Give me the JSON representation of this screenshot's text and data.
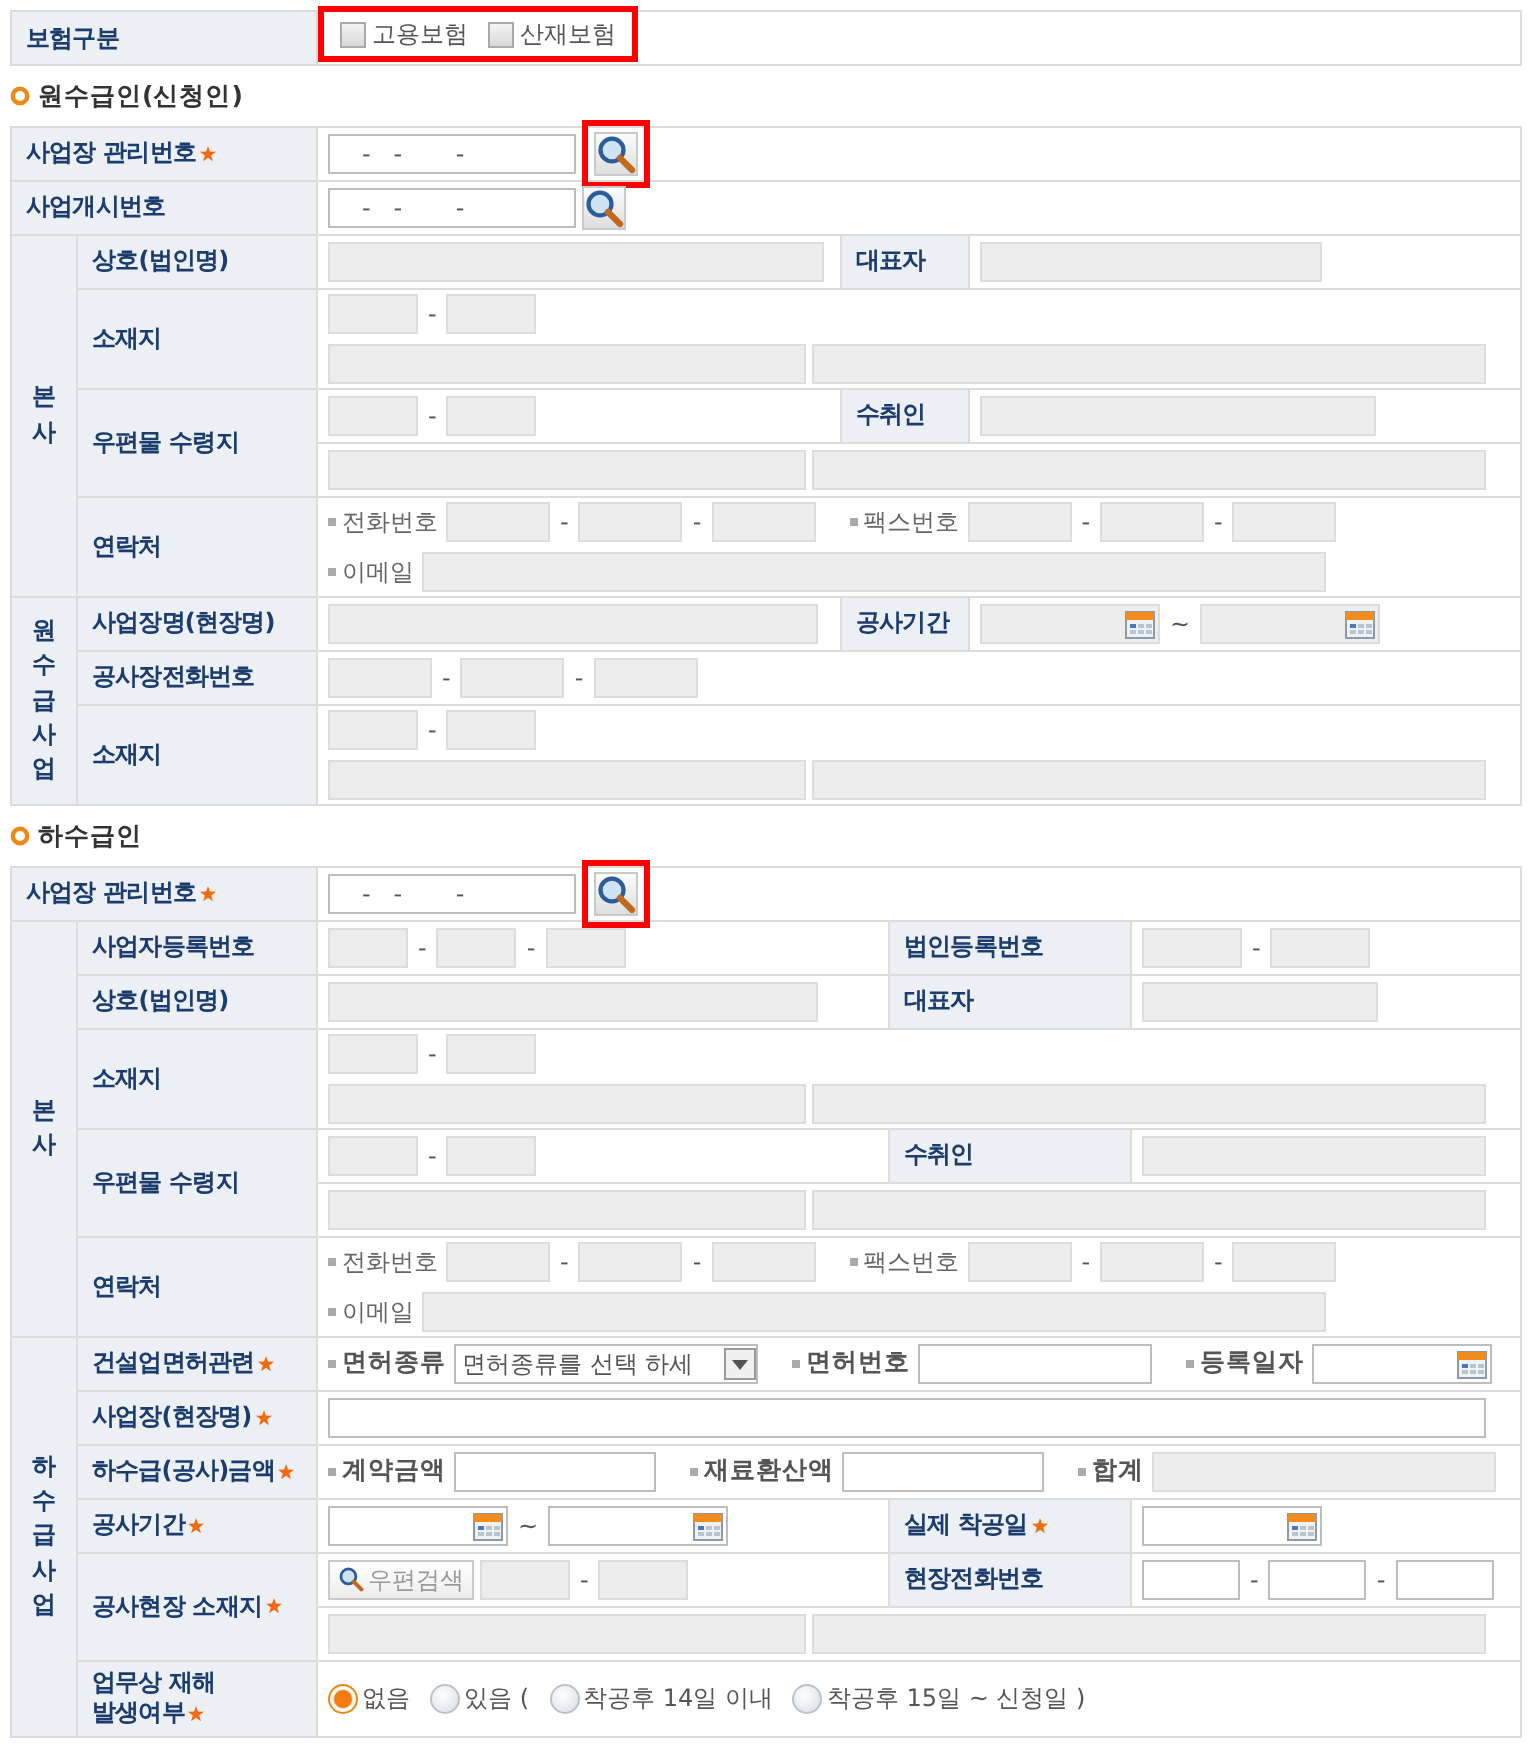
{
  "insurance_type": {
    "label": "보험구분",
    "highlighted": true,
    "options": [
      {
        "label": "고용보험",
        "checked": false
      },
      {
        "label": "산재보험",
        "checked": false
      }
    ]
  },
  "sections": [
    {
      "title": "원수급인(신청인)",
      "rows": [
        {
          "label": "사업장 관리번호",
          "required": true,
          "lines": [
            [
              {
                "kind": "mgmt-no",
                "value": "-   -       -",
                "disabled": false
              },
              {
                "kind": "lookup",
                "highlighted": true
              }
            ]
          ]
        },
        {
          "label": "사업개시번호",
          "lines": [
            [
              {
                "kind": "mgmt-no",
                "value": "-   -       -",
                "disabled": false
              },
              {
                "kind": "lookup",
                "highlighted": false
              }
            ]
          ]
        },
        {
          "group": "본사",
          "rows": [
            {
              "label": "상호(법인명)",
              "lines": [
                [
                  {
                    "kind": "name",
                    "disabled": true
                  }
                ]
              ],
              "side": {
                "label": "대표자",
                "lines": [
                  [
                    {
                      "kind": "ceo",
                      "disabled": true
                    }
                  ]
                ]
              }
            },
            {
              "label": "소재지",
              "lines": [
                [
                  {
                    "kind": "zip",
                    "disabled": true
                  },
                  {
                    "kind": "dash",
                    "text": "-"
                  },
                  {
                    "kind": "zip",
                    "disabled": true
                  }
                ],
                [
                  {
                    "kind": "addr-base",
                    "disabled": true
                  },
                  {
                    "kind": "addr-detail",
                    "disabled": true
                  }
                ]
              ]
            },
            {
              "label": "우편물 수령지",
              "lines": [
                [
                  {
                    "kind": "zip",
                    "disabled": true
                  },
                  {
                    "kind": "dash",
                    "text": "-"
                  },
                  {
                    "kind": "zip",
                    "disabled": true
                  }
                ]
              ],
              "side": {
                "label": "수취인",
                "lines": [
                  [
                    {
                      "kind": "recipient",
                      "disabled": true
                    }
                  ]
                ]
              },
              "next_line": [
                {
                  "kind": "addr-base",
                  "disabled": true
                },
                {
                  "kind": "addr-detail",
                  "disabled": true
                }
              ]
            },
            {
              "label": "연락처",
              "lines": [
                [
                  {
                    "kind": "caption",
                    "text": "전화번호",
                    "bold": false
                  },
                  {
                    "kind": "phone",
                    "disabled": true
                  },
                  {
                    "kind": "dash",
                    "text": "-"
                  },
                  {
                    "kind": "phone",
                    "disabled": true
                  },
                  {
                    "kind": "dash",
                    "text": "-"
                  },
                  {
                    "kind": "phone",
                    "disabled": true
                  },
                  {
                    "kind": "caption",
                    "text": "팩스번호",
                    "bold": false
                  },
                  {
                    "kind": "phone",
                    "disabled": true
                  },
                  {
                    "kind": "dash",
                    "text": "-"
                  },
                  {
                    "kind": "phone",
                    "disabled": true
                  },
                  {
                    "kind": "dash",
                    "text": "-"
                  },
                  {
                    "kind": "phone",
                    "disabled": true
                  }
                ],
                [
                  {
                    "kind": "caption",
                    "text": "이메일",
                    "bold": false
                  },
                  {
                    "kind": "email",
                    "disabled": true
                  }
                ]
              ]
            }
          ]
        },
        {
          "group": "원수급사업",
          "rows": [
            {
              "label": "사업장명(현장명)",
              "lines": [
                [
                  {
                    "kind": "site-name",
                    "disabled": true
                  }
                ]
              ],
              "side": {
                "label": "공사기간",
                "lines": [
                  [
                    {
                      "kind": "date",
                      "disabled": true
                    },
                    {
                      "kind": "tilde",
                      "text": "~"
                    },
                    {
                      "kind": "date",
                      "disabled": true
                    }
                  ]
                ]
              }
            },
            {
              "label": "공사장전화번호",
              "lines": [
                [
                  {
                    "kind": "phone",
                    "disabled": true
                  },
                  {
                    "kind": "dash",
                    "text": "-"
                  },
                  {
                    "kind": "phone",
                    "disabled": true
                  },
                  {
                    "kind": "dash",
                    "text": "-"
                  },
                  {
                    "kind": "phone",
                    "disabled": true
                  }
                ]
              ]
            },
            {
              "label": "소재지",
              "lines": [
                [
                  {
                    "kind": "zip",
                    "disabled": true
                  },
                  {
                    "kind": "dash",
                    "text": "-"
                  },
                  {
                    "kind": "zip",
                    "disabled": true
                  }
                ],
                [
                  {
                    "kind": "addr-base",
                    "disabled": true
                  },
                  {
                    "kind": "addr-detail",
                    "disabled": true
                  }
                ]
              ]
            }
          ]
        }
      ]
    },
    {
      "title": "하수급인",
      "rows": [
        {
          "label": "사업장 관리번호",
          "required": true,
          "lines": [
            [
              {
                "kind": "mgmt-no",
                "value": "-   -       -",
                "disabled": false
              },
              {
                "kind": "lookup",
                "highlighted": true
              }
            ]
          ]
        },
        {
          "group": "본사",
          "rows": [
            {
              "label": "사업자등록번호",
              "lines": [
                [
                  {
                    "kind": "biz-no",
                    "disabled": true
                  },
                  {
                    "kind": "dash",
                    "text": "-"
                  },
                  {
                    "kind": "biz-no",
                    "disabled": true
                  },
                  {
                    "kind": "dash",
                    "text": "-"
                  },
                  {
                    "kind": "biz-no",
                    "disabled": true
                  }
                ]
              ],
              "side": {
                "label": "법인등록번호",
                "lines": [
                  [
                    {
                      "kind": "corp-no",
                      "disabled": true
                    },
                    {
                      "kind": "dash",
                      "text": "-"
                    },
                    {
                      "kind": "corp-no",
                      "disabled": true
                    }
                  ]
                ]
              }
            },
            {
              "label": "상호(법인명)",
              "lines": [
                [
                  {
                    "kind": "name",
                    "disabled": true
                  }
                ]
              ],
              "side": {
                "label": "대표자",
                "lines": [
                  [
                    {
                      "kind": "ceo",
                      "disabled": true
                    }
                  ]
                ]
              }
            },
            {
              "label": "소재지",
              "lines": [
                [
                  {
                    "kind": "zip",
                    "disabled": true
                  },
                  {
                    "kind": "dash",
                    "text": "-"
                  },
                  {
                    "kind": "zip",
                    "disabled": true
                  }
                ],
                [
                  {
                    "kind": "addr-base",
                    "disabled": true
                  },
                  {
                    "kind": "addr-detail",
                    "disabled": true
                  }
                ]
              ]
            },
            {
              "label": "우편물 수령지",
              "lines": [
                [
                  {
                    "kind": "zip",
                    "disabled": true
                  },
                  {
                    "kind": "dash",
                    "text": "-"
                  },
                  {
                    "kind": "zip",
                    "disabled": true
                  }
                ]
              ],
              "side": {
                "label": "수취인",
                "lines": [
                  [
                    {
                      "kind": "recipient",
                      "disabled": true
                    }
                  ]
                ]
              },
              "next_line": [
                {
                  "kind": "addr-base",
                  "disabled": true
                },
                {
                  "kind": "addr-detail",
                  "disabled": true
                }
              ]
            },
            {
              "label": "연락처",
              "lines": [
                [
                  {
                    "kind": "caption",
                    "text": "전화번호",
                    "bold": false
                  },
                  {
                    "kind": "phone",
                    "disabled": true
                  },
                  {
                    "kind": "dash",
                    "text": "-"
                  },
                  {
                    "kind": "phone",
                    "disabled": true
                  },
                  {
                    "kind": "dash",
                    "text": "-"
                  },
                  {
                    "kind": "phone",
                    "disabled": true
                  },
                  {
                    "kind": "caption",
                    "text": "팩스번호",
                    "bold": false
                  },
                  {
                    "kind": "phone",
                    "disabled": true
                  },
                  {
                    "kind": "dash",
                    "text": "-"
                  },
                  {
                    "kind": "phone",
                    "disabled": true
                  },
                  {
                    "kind": "dash",
                    "text": "-"
                  },
                  {
                    "kind": "phone",
                    "disabled": true
                  }
                ],
                [
                  {
                    "kind": "caption",
                    "text": "이메일",
                    "bold": false
                  },
                  {
                    "kind": "email",
                    "disabled": true
                  }
                ]
              ]
            }
          ]
        },
        {
          "group": "하수급사업",
          "rows": [
            {
              "label": "건설업면허관련",
              "required": true,
              "lines": [
                [
                  {
                    "kind": "caption",
                    "text": "면허종류",
                    "bold": true
                  },
                  {
                    "kind": "select",
                    "value": "면허종류를 선택 하세"
                  },
                  {
                    "kind": "caption",
                    "text": "면허번호",
                    "bold": true
                  },
                  {
                    "kind": "license-no",
                    "disabled": false
                  },
                  {
                    "kind": "caption",
                    "text": "등록일자",
                    "bold": true
                  },
                  {
                    "kind": "date",
                    "disabled": false
                  }
                ]
              ]
            },
            {
              "label": "사업장(현장명)",
              "required": true,
              "lines": [
                [
                  {
                    "kind": "site-wide",
                    "disabled": false
                  }
                ]
              ]
            },
            {
              "label": "하수급(공사)금액",
              "required": true,
              "lines": [
                [
                  {
                    "kind": "caption",
                    "text": "계약금액",
                    "bold": true
                  },
                  {
                    "kind": "amount",
                    "disabled": false
                  },
                  {
                    "kind": "caption",
                    "text": "재료환산액",
                    "bold": true
                  },
                  {
                    "kind": "amount",
                    "disabled": false
                  },
                  {
                    "kind": "caption",
                    "text": "합계",
                    "bold": true
                  },
                  {
                    "kind": "total",
                    "disabled": true
                  }
                ]
              ]
            },
            {
              "label": "공사기간",
              "required": true,
              "lines": [
                [
                  {
                    "kind": "date",
                    "disabled": false
                  },
                  {
                    "kind": "tilde",
                    "text": "~"
                  },
                  {
                    "kind": "date",
                    "disabled": false
                  }
                ]
              ],
              "side": {
                "label": "실제 착공일",
                "required": true,
                "lines": [
                  [
                    {
                      "kind": "date",
                      "disabled": false
                    }
                  ]
                ]
              }
            },
            {
              "label": "공사현장 소재지",
              "required": true,
              "lines": [
                [
                  {
                    "kind": "zip-search",
                    "label": "우편검색"
                  },
                  {
                    "kind": "zip",
                    "disabled": true
                  },
                  {
                    "kind": "dash",
                    "text": "-"
                  },
                  {
                    "kind": "zip",
                    "disabled": true
                  }
                ]
              ],
              "side": {
                "label": "현장전화번호",
                "lines": [
                  [
                    {
                      "kind": "site-phone",
                      "disabled": false
                    },
                    {
                      "kind": "dash",
                      "text": "-"
                    },
                    {
                      "kind": "site-phone",
                      "disabled": false
                    },
                    {
                      "kind": "dash",
                      "text": "-"
                    },
                    {
                      "kind": "site-phone",
                      "disabled": false
                    }
                  ]
                ]
              },
              "next_line": [
                {
                  "kind": "addr-base",
                  "disabled": true
                },
                {
                  "kind": "addr-detail",
                  "disabled": true
                }
              ]
            },
            {
              "label": "업무상 재해 발생여부",
              "required": true,
              "lines": [
                [
                  {
                    "kind": "radio",
                    "label": "없음",
                    "selected": true
                  },
                  {
                    "kind": "radio",
                    "label": "있음 (",
                    "selected": false
                  },
                  {
                    "kind": "radio",
                    "label": "착공후 14일 이내",
                    "selected": false
                  },
                  {
                    "kind": "radio",
                    "label": "착공후 15일 ~ 신청일 )",
                    "selected": false
                  }
                ]
              ]
            }
          ]
        }
      ]
    }
  ]
}
